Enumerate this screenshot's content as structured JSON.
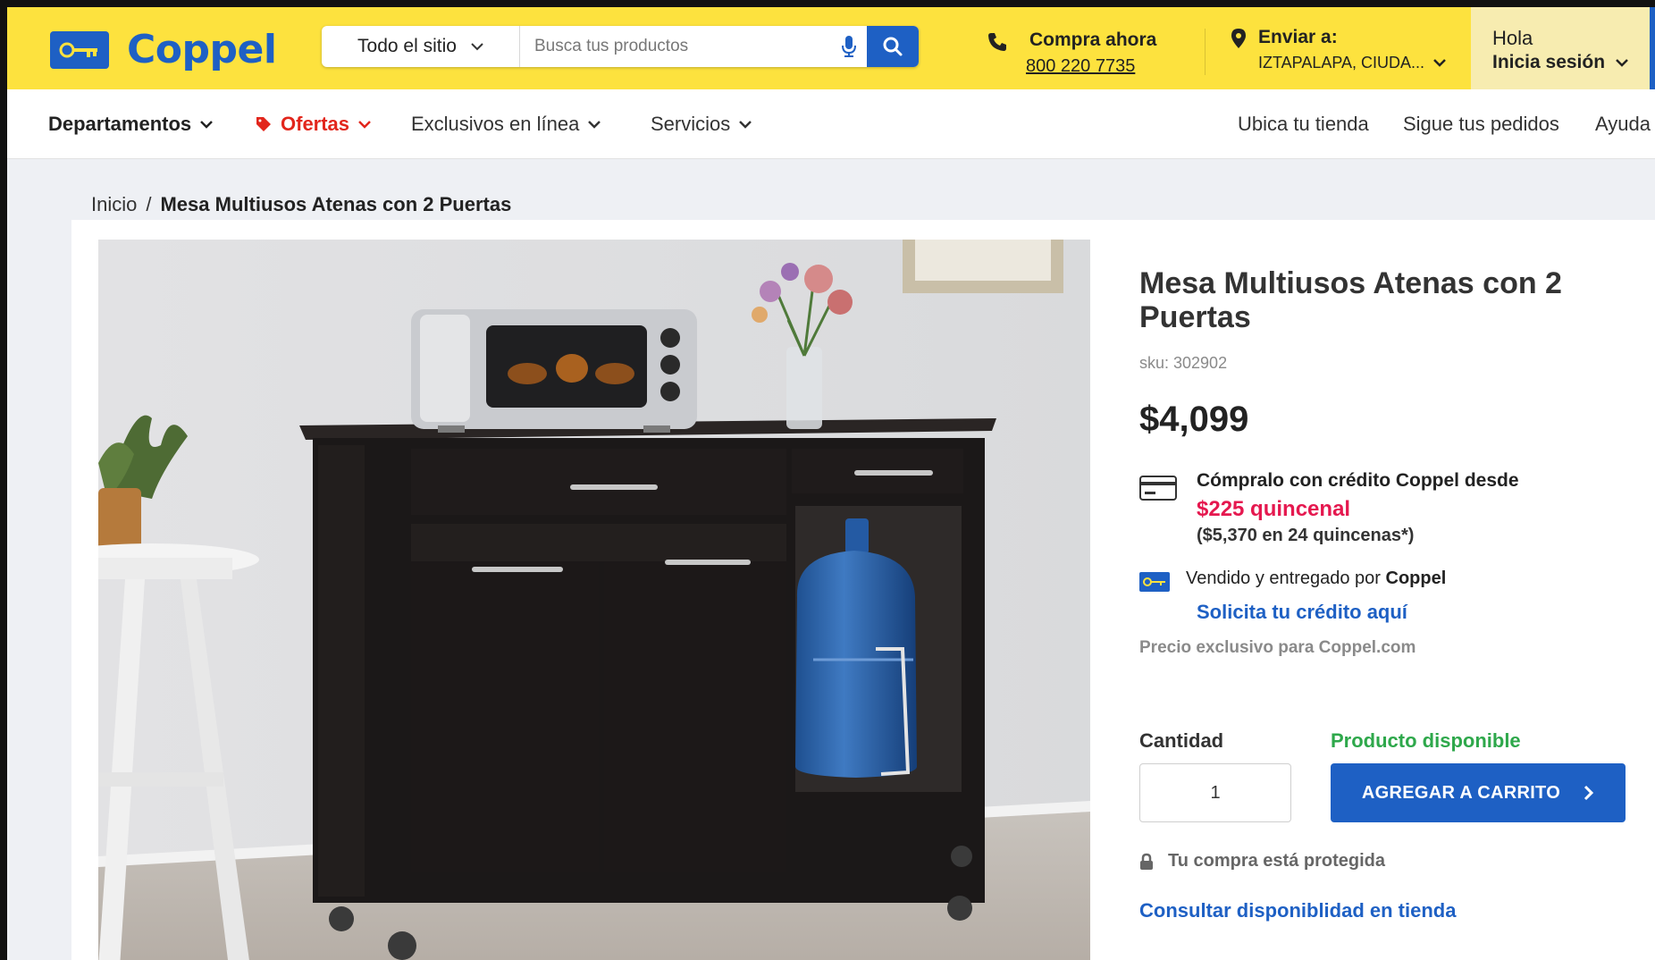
{
  "brand": {
    "name": "Coppel",
    "primary_color": "#1e60c4",
    "header_color": "#fde23e"
  },
  "search": {
    "scope": "Todo el sitio",
    "placeholder": "Busca tus productos"
  },
  "contact": {
    "label": "Compra ahora",
    "phone": "800 220 7735"
  },
  "shipping": {
    "label": "Enviar a:",
    "location": "IZTAPALAPA, CIUDA..."
  },
  "account": {
    "greeting": "Hola",
    "action": "Inicia sesión"
  },
  "nav": {
    "departments": "Departamentos",
    "offers": "Ofertas",
    "exclusive": "Exclusivos en línea",
    "services": "Servicios",
    "store_locator": "Ubica tu tienda",
    "track_orders": "Sigue tus pedidos",
    "help": "Ayuda"
  },
  "breadcrumb": {
    "home": "Inicio",
    "separator": "/",
    "current": "Mesa Multiusos Atenas con 2 Puertas"
  },
  "product": {
    "title": "Mesa Multiusos Atenas con 2 Puertas",
    "sku": "sku: 302902",
    "price": "$4,099",
    "credit_line": "Cómpralo con crédito Coppel desde",
    "installment": "$225 quincenal",
    "installment_total": "($5,370 en 24 quincenas*)",
    "seller_prefix": "Vendido y entregado por",
    "seller_name": "Coppel",
    "credit_link": "Solicita tu crédito aquí",
    "exclusive_note": "Precio exclusivo para Coppel.com",
    "quantity_label": "Cantidad",
    "quantity_value": "1",
    "availability": "Producto disponible",
    "add_to_cart": "AGREGAR A CARRITO",
    "protected": "Tu compra está protegida",
    "store_check": "Consultar disponiblidad en tienda"
  }
}
